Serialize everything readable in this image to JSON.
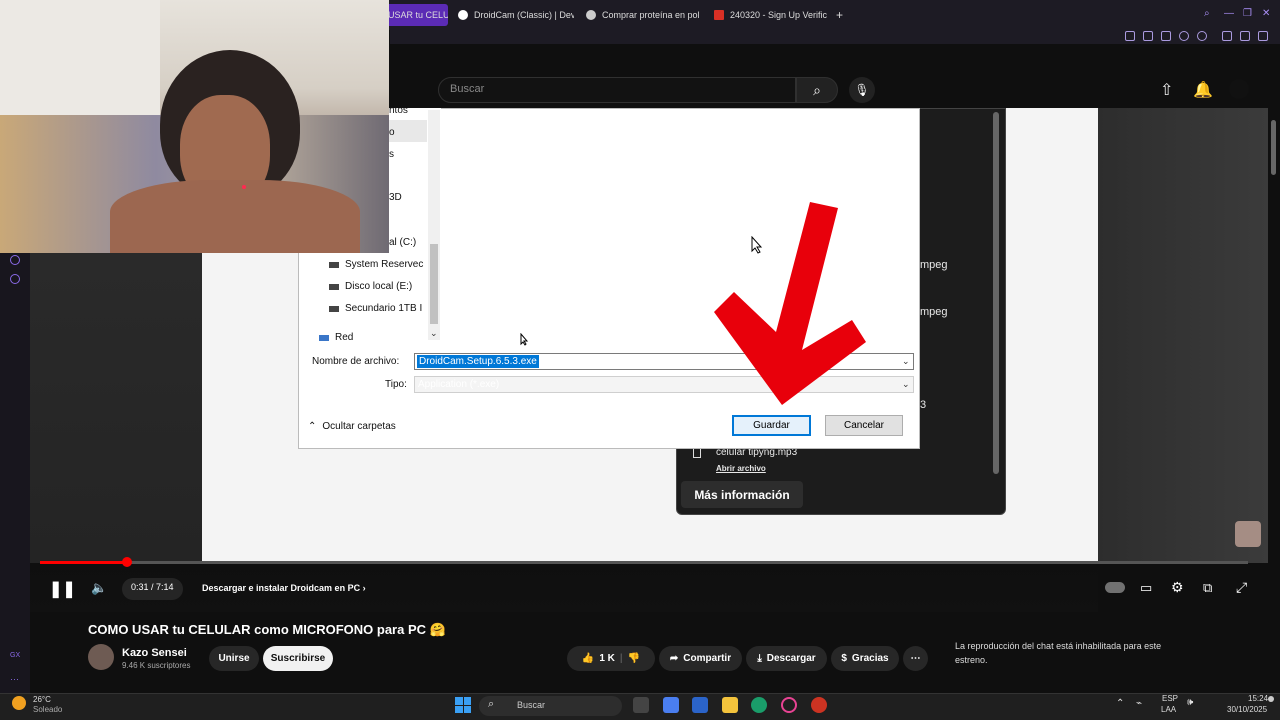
{
  "browser": {
    "tabs": [
      {
        "label": "USAR tu CELU"
      },
      {
        "label": "DroidCam (Classic) | Dev"
      },
      {
        "label": "Comprar proteína en pol"
      },
      {
        "label": "240320 - Sign Up Verific"
      }
    ],
    "new_tab": "+"
  },
  "youtube_header": {
    "search_placeholder": "Buscar"
  },
  "file_dialog": {
    "nav_items": [
      "ntos",
      "o",
      "s",
      "3D",
      "al (C:)",
      "System Reservec",
      "Disco local (E:)",
      "Secundario 1TB I",
      "Red"
    ],
    "filename_label": "Nombre de archivo:",
    "filename_value": "DroidCam.Setup.6.5.3.exe",
    "type_label": "Tipo:",
    "type_value": "Application (*.exe)",
    "hide_folders": "Ocultar carpetas",
    "save_button": "Guardar",
    "cancel_button": "Cancelar"
  },
  "download_panel": {
    "item1": "mpeg",
    "item2": "mpeg",
    "item3": "3",
    "file_name": "celular tipyng.mp3",
    "open_file": "Abrir archivo",
    "more_info": "Más información"
  },
  "player": {
    "time": "0:31 / 7:14",
    "chapter": "Descargar e instalar Droidcam en PC",
    "progress_fraction": 0.072
  },
  "video": {
    "title": "COMO USAR tu CELULAR como MICROFONO para PC 🤗",
    "channel": "Kazo Sensei",
    "subscribers": "9.46 K suscriptores",
    "join": "Unirse",
    "subscribe": "Suscribirse",
    "likes": "1 K",
    "share": "Compartir",
    "download": "Descargar",
    "thanks": "Gracias",
    "chat_note": "La reproducción del chat está inhabilitada para este estreno."
  },
  "taskbar": {
    "weather_temp": "26°C",
    "weather_desc": "Soleado",
    "search": "Buscar",
    "lang1": "ESP",
    "lang2": "LAA",
    "time": "15:24",
    "date": "30/10/2025"
  },
  "colors": {
    "accent_tab": "#5b2bb5",
    "progress": "#ff0000",
    "selection": "#0078d7",
    "arrow": "#e8000b"
  }
}
